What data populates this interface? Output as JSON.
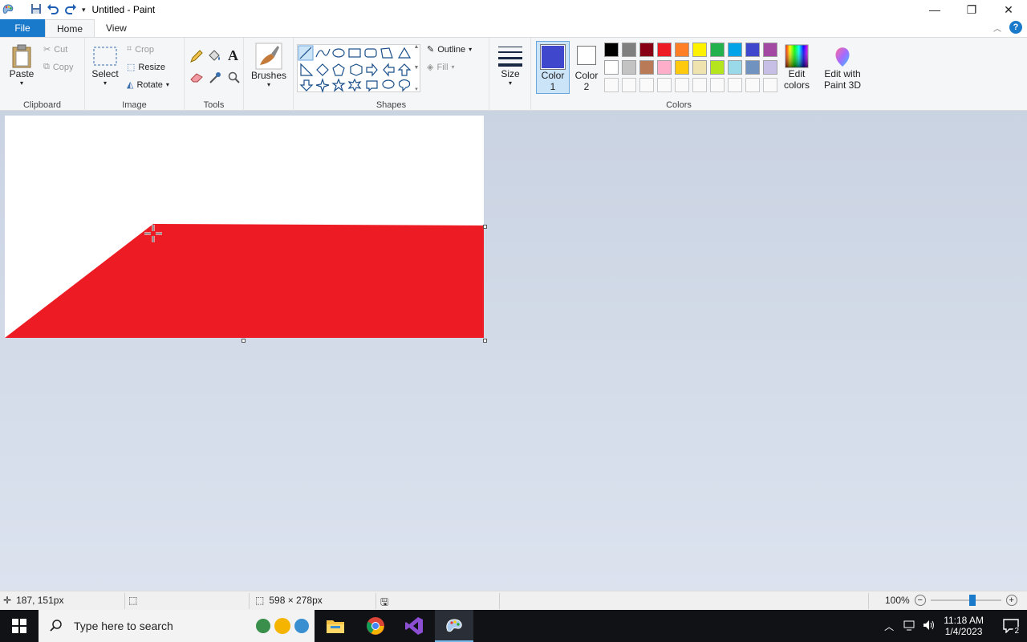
{
  "window": {
    "title": "Untitled - Paint",
    "minimize": "—",
    "restore": "❐",
    "close": "✕"
  },
  "tabs": {
    "file": "File",
    "home": "Home",
    "view": "View"
  },
  "ribbon": {
    "clipboard": {
      "label": "Clipboard",
      "paste": "Paste",
      "cut": "Cut",
      "copy": "Copy"
    },
    "image": {
      "label": "Image",
      "select": "Select",
      "crop": "Crop",
      "resize": "Resize",
      "rotate": "Rotate"
    },
    "tools": {
      "label": "Tools"
    },
    "brushes": {
      "label": "Brushes"
    },
    "shapes": {
      "label": "Shapes",
      "outline": "Outline",
      "fill": "Fill"
    },
    "size": {
      "label": "Size"
    },
    "colors": {
      "label": "Colors",
      "color1_a": "Color",
      "color1_b": "1",
      "color2_a": "Color",
      "color2_b": "2",
      "color1_value": "#3f48cc",
      "color2_value": "#ffffff",
      "edit_colors_a": "Edit",
      "edit_colors_b": "colors",
      "paint3d_a": "Edit with",
      "paint3d_b": "Paint 3D",
      "palette_row1": [
        "#000000",
        "#7f7f7f",
        "#880015",
        "#ed1c24",
        "#ff7f27",
        "#fff200",
        "#22b14c",
        "#00a2e8",
        "#3f48cc",
        "#a349a4"
      ],
      "palette_row2": [
        "#ffffff",
        "#c3c3c3",
        "#b97a57",
        "#ffaec9",
        "#ffc90e",
        "#efe4b0",
        "#b5e61d",
        "#99d9ea",
        "#7092be",
        "#c8bfe7"
      ]
    }
  },
  "canvas": {
    "shape_fill": "#ed1c24"
  },
  "status": {
    "cursor_pos": "187, 151px",
    "selection_size": "598 × 278px",
    "zoom": "100%",
    "zoom_level": 0.6
  },
  "taskbar": {
    "search_placeholder": "Type here to search",
    "time": "11:18 AM",
    "date": "1/4/2023",
    "notifications": "2"
  }
}
